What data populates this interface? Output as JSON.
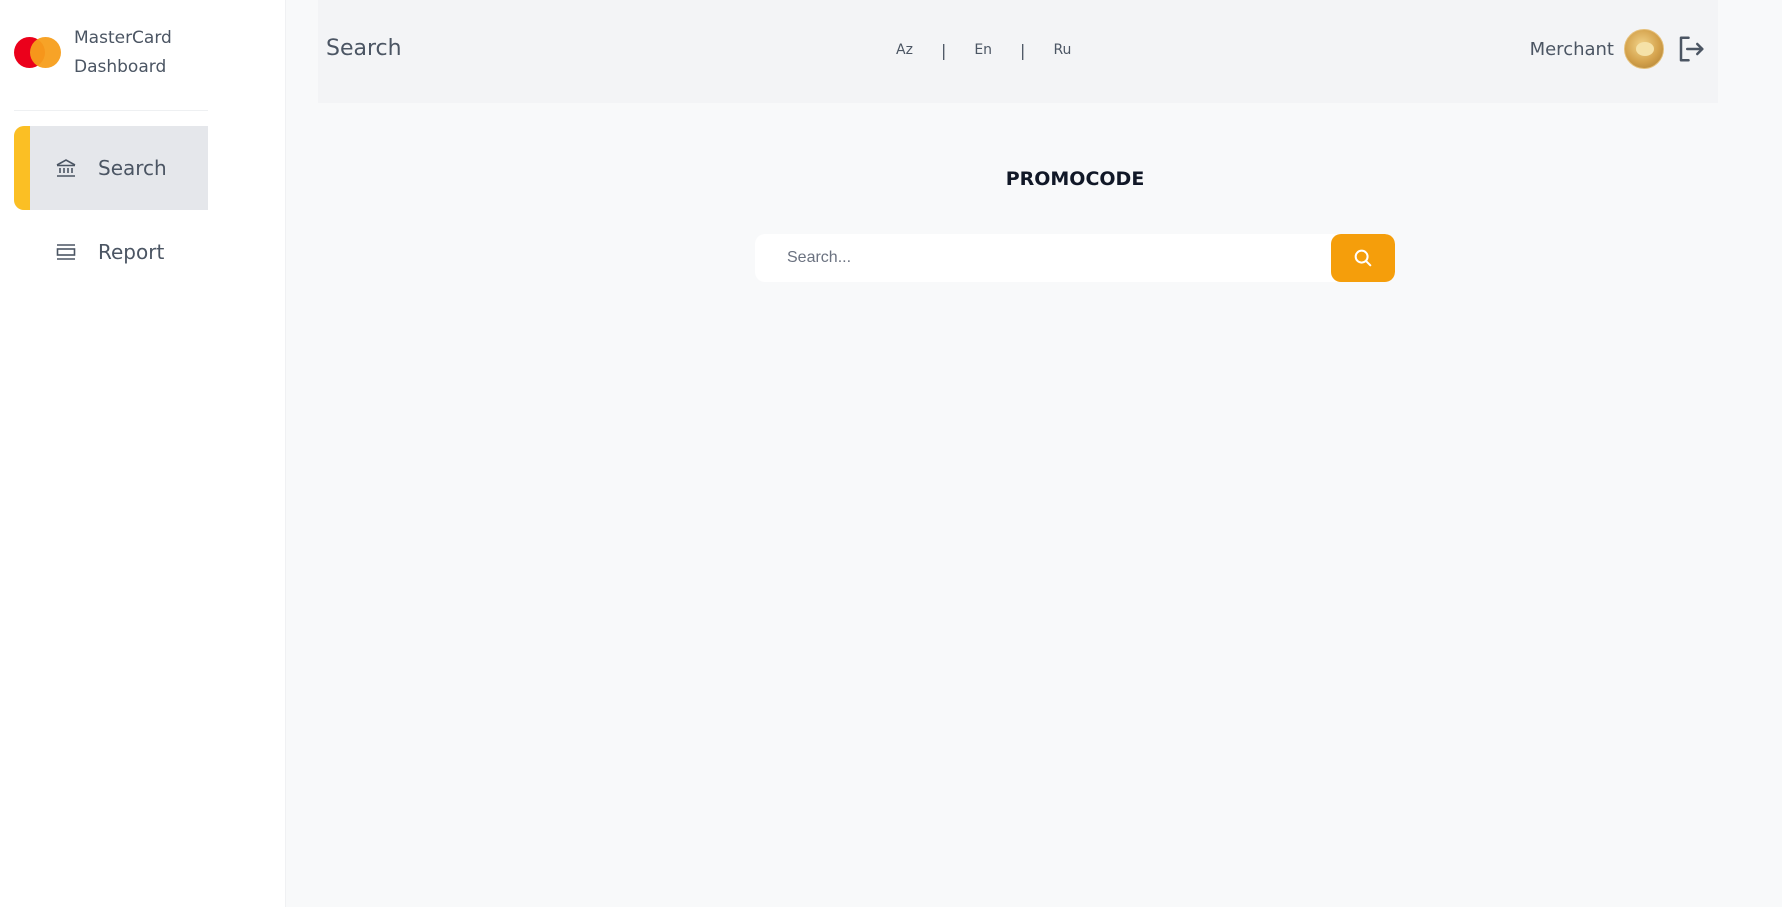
{
  "brand": {
    "line1": "MasterCard",
    "line2": "Dashboard"
  },
  "sidebar": {
    "items": [
      {
        "label": "Search",
        "icon": "bank-icon",
        "active": true
      },
      {
        "label": "Report",
        "icon": "list-icon",
        "active": false
      }
    ]
  },
  "header": {
    "title": "Search",
    "languages": [
      "Az",
      "En",
      "Ru"
    ],
    "separator": "|",
    "user_name": "Merchant"
  },
  "main": {
    "heading": "PROMOCODE",
    "search": {
      "value": "",
      "placeholder": "Search..."
    }
  },
  "colors": {
    "accent": "#f59e0b",
    "active_bar": "#fbbf24",
    "active_bg": "#e5e7eb",
    "mc_red": "#eb001b",
    "mc_orange": "#f79e1b"
  }
}
